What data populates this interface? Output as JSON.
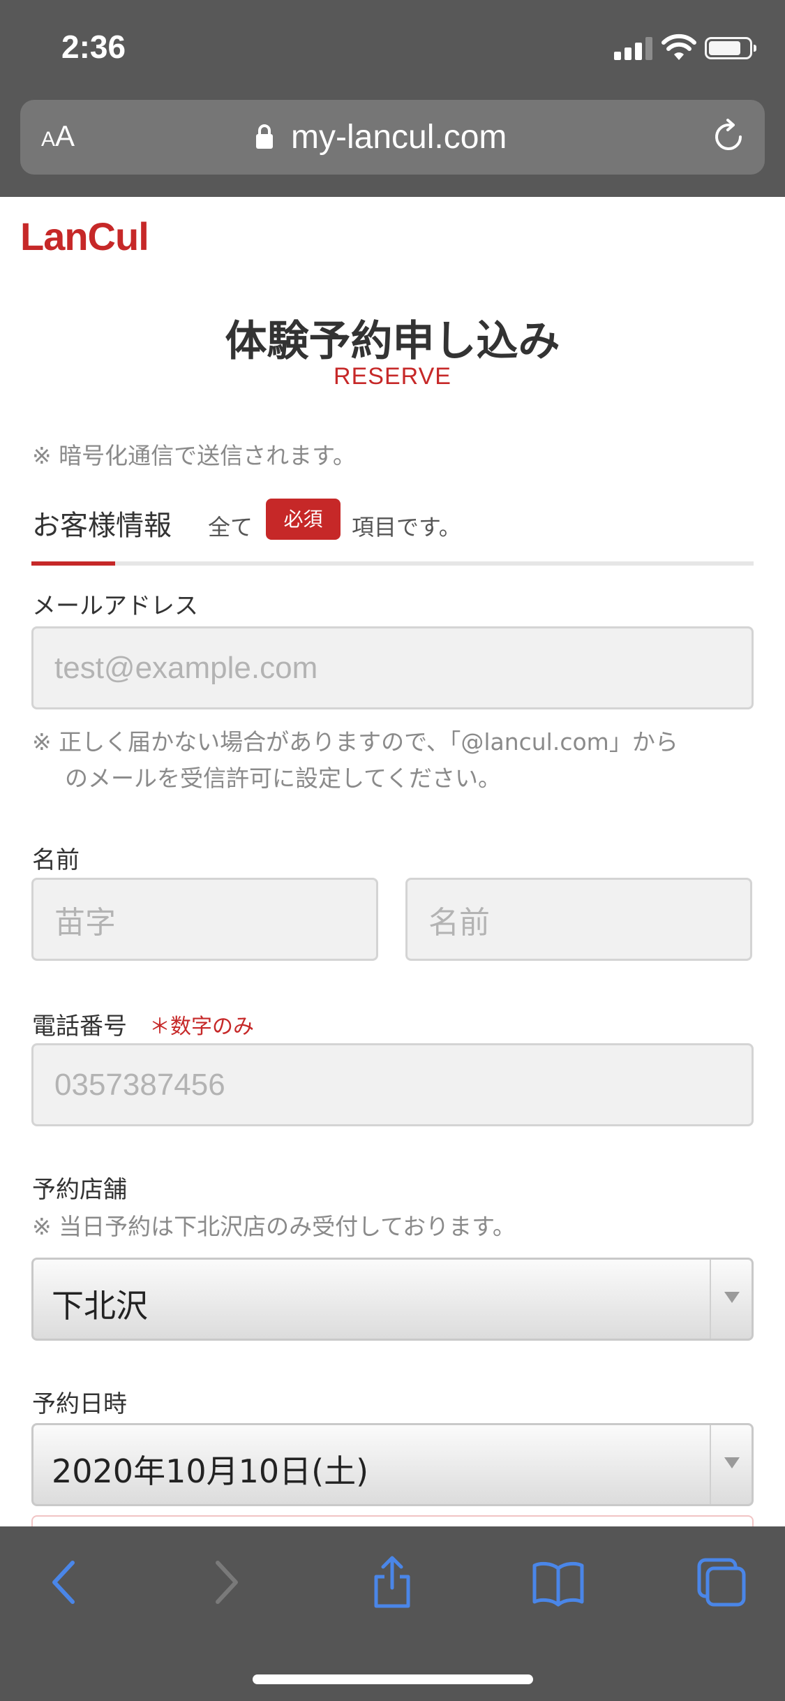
{
  "status_bar": {
    "time": "2:36",
    "signal_bars_filled": 3,
    "signal_bars_total": 4,
    "battery_level": 0.8
  },
  "browser": {
    "text_size_button": {
      "small": "A",
      "large": "A"
    },
    "url": "my-lancul.com",
    "colors": {
      "chrome": "#585858",
      "toolbar_icons": "#4a86e8"
    }
  },
  "site": {
    "logo": "LanCul",
    "brand_color": "#c62828"
  },
  "form": {
    "title": "体験予約申し込み",
    "subtitle": "RESERVE",
    "encryption_note": "※ 暗号化通信で送信されます。",
    "section_tab": "お客様情報",
    "required_prefix": "全て",
    "required_badge": "必須",
    "required_suffix": "項目です。",
    "email": {
      "label": "メールアドレス",
      "placeholder": "test@example.com",
      "note_line1": "※ 正しく届かない場合がありますので、「@lancul.com」から",
      "note_line2": "のメールを受信許可に設定してください。"
    },
    "name": {
      "label": "名前",
      "last_name_placeholder": "苗字",
      "first_name_placeholder": "名前"
    },
    "phone": {
      "label": "電話番号",
      "note": "＊数字のみ",
      "placeholder": "0357387456"
    },
    "store": {
      "label": "予約店舗",
      "note": "※ 当日予約は下北沢店のみ受付しております。",
      "selected": "下北沢"
    },
    "datetime": {
      "label": "予約日時",
      "selected": "2020年10月10日(土)"
    }
  }
}
